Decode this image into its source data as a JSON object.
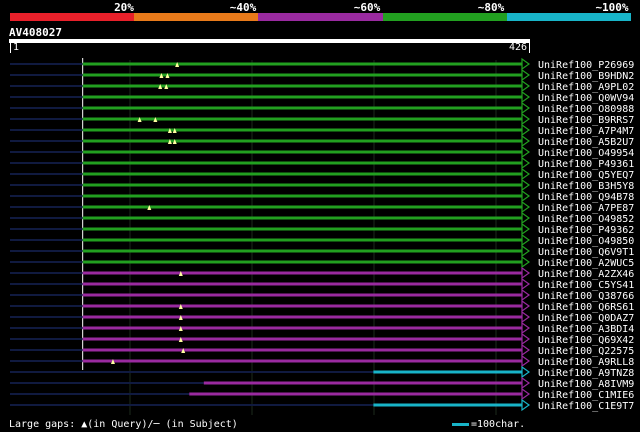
{
  "colors": {
    "background": "#000000",
    "green": "#22a020",
    "purple": "#9a2aa0",
    "cyan": "#18b4c8",
    "gap": "#101a40",
    "grid": "#3a4a2a"
  },
  "scale": {
    "labels": [
      "20%",
      "~40%",
      "~60%",
      "~80%",
      "~100%"
    ],
    "segments": [
      "#e8202a",
      "#e87a1a",
      "#9a2aa0",
      "#22a020",
      "#18b4c8"
    ]
  },
  "query": {
    "id": "AV408027",
    "start": "1",
    "end": "426",
    "length": 426
  },
  "legend": {
    "gaps_text": "Large gaps: ▲(in Query)/─ (in Subject)",
    "scale_text": "=100char."
  },
  "chart_data": {
    "type": "alignment",
    "query_length": 426,
    "hits": [
      {
        "name": "UniRef100_P26969",
        "identity": "~80%",
        "color": "green",
        "start": 60,
        "end": 426,
        "gaps": [
          138
        ]
      },
      {
        "name": "UniRef100_B9HDN2",
        "identity": "~80%",
        "color": "green",
        "start": 60,
        "end": 426,
        "gaps": [
          125,
          130
        ]
      },
      {
        "name": "UniRef100_A9PL02",
        "identity": "~80%",
        "color": "green",
        "start": 60,
        "end": 426,
        "gaps": [
          124,
          129
        ]
      },
      {
        "name": "UniRef100_Q0WV94",
        "identity": "~80%",
        "color": "green",
        "start": 60,
        "end": 426,
        "gaps": []
      },
      {
        "name": "UniRef100_O80988",
        "identity": "~80%",
        "color": "green",
        "start": 60,
        "end": 426,
        "gaps": []
      },
      {
        "name": "UniRef100_B9RRS7",
        "identity": "~80%",
        "color": "green",
        "start": 60,
        "end": 426,
        "gaps": [
          107,
          120
        ]
      },
      {
        "name": "UniRef100_A7P4M7",
        "identity": "~80%",
        "color": "green",
        "start": 60,
        "end": 426,
        "gaps": [
          132,
          136
        ]
      },
      {
        "name": "UniRef100_A5B2U7",
        "identity": "~80%",
        "color": "green",
        "start": 60,
        "end": 426,
        "gaps": [
          132,
          136
        ]
      },
      {
        "name": "UniRef100_O49954",
        "identity": "~80%",
        "color": "green",
        "start": 60,
        "end": 426,
        "gaps": []
      },
      {
        "name": "UniRef100_P49361",
        "identity": "~80%",
        "color": "green",
        "start": 60,
        "end": 426,
        "gaps": []
      },
      {
        "name": "UniRef100_Q5YEQ7",
        "identity": "~80%",
        "color": "green",
        "start": 60,
        "end": 426,
        "gaps": []
      },
      {
        "name": "UniRef100_B3H5Y8",
        "identity": "~80%",
        "color": "green",
        "start": 60,
        "end": 426,
        "gaps": []
      },
      {
        "name": "UniRef100_Q94B78",
        "identity": "~80%",
        "color": "green",
        "start": 60,
        "end": 426,
        "gaps": []
      },
      {
        "name": "UniRef100_A7PE87",
        "identity": "~80%",
        "color": "green",
        "start": 60,
        "end": 426,
        "gaps": [
          115
        ]
      },
      {
        "name": "UniRef100_O49852",
        "identity": "~80%",
        "color": "green",
        "start": 60,
        "end": 426,
        "gaps": []
      },
      {
        "name": "UniRef100_P49362",
        "identity": "~80%",
        "color": "green",
        "start": 60,
        "end": 426,
        "gaps": []
      },
      {
        "name": "UniRef100_O49850",
        "identity": "~80%",
        "color": "green",
        "start": 60,
        "end": 426,
        "gaps": []
      },
      {
        "name": "UniRef100_Q6V9T1",
        "identity": "~80%",
        "color": "green",
        "start": 60,
        "end": 426,
        "gaps": []
      },
      {
        "name": "UniRef100_A2WUC5",
        "identity": "~80%",
        "color": "green",
        "start": 60,
        "end": 426,
        "gaps": []
      },
      {
        "name": "UniRef100_A2ZX46",
        "identity": "~60%",
        "color": "purple",
        "start": 60,
        "end": 426,
        "gaps": [
          141
        ]
      },
      {
        "name": "UniRef100_C5YS41",
        "identity": "~60%",
        "color": "purple",
        "start": 60,
        "end": 426,
        "gaps": []
      },
      {
        "name": "UniRef100_Q38766",
        "identity": "~60%",
        "color": "purple",
        "start": 60,
        "end": 426,
        "gaps": []
      },
      {
        "name": "UniRef100_Q6RS61",
        "identity": "~60%",
        "color": "purple",
        "start": 60,
        "end": 426,
        "gaps": [
          141
        ]
      },
      {
        "name": "UniRef100_Q0DAZ7",
        "identity": "~60%",
        "color": "purple",
        "start": 60,
        "end": 426,
        "gaps": [
          141
        ]
      },
      {
        "name": "UniRef100_A3BDI4",
        "identity": "~60%",
        "color": "purple",
        "start": 60,
        "end": 426,
        "gaps": [
          141
        ]
      },
      {
        "name": "UniRef100_Q69X42",
        "identity": "~60%",
        "color": "purple",
        "start": 60,
        "end": 426,
        "gaps": [
          141
        ]
      },
      {
        "name": "UniRef100_Q22575",
        "identity": "~60%",
        "color": "purple",
        "start": 60,
        "end": 426,
        "gaps": [
          143
        ]
      },
      {
        "name": "UniRef100_A9RLL8",
        "identity": "~60%",
        "color": "purple",
        "start": 60,
        "end": 426,
        "gaps": [
          85
        ]
      },
      {
        "name": "UniRef100_A9TNZ8",
        "identity": "~100%",
        "color": "cyan",
        "start": 300,
        "end": 426,
        "gaps": []
      },
      {
        "name": "UniRef100_A8IVM9",
        "identity": "~60%",
        "color": "purple",
        "start": 160,
        "end": 426,
        "gaps": []
      },
      {
        "name": "UniRef100_C1MIE6",
        "identity": "~60%",
        "color": "purple",
        "start": 148,
        "end": 426,
        "gaps": []
      },
      {
        "name": "UniRef100_C1E9T7",
        "identity": "~100%",
        "color": "cyan",
        "start": 300,
        "end": 426,
        "gaps": []
      }
    ]
  }
}
